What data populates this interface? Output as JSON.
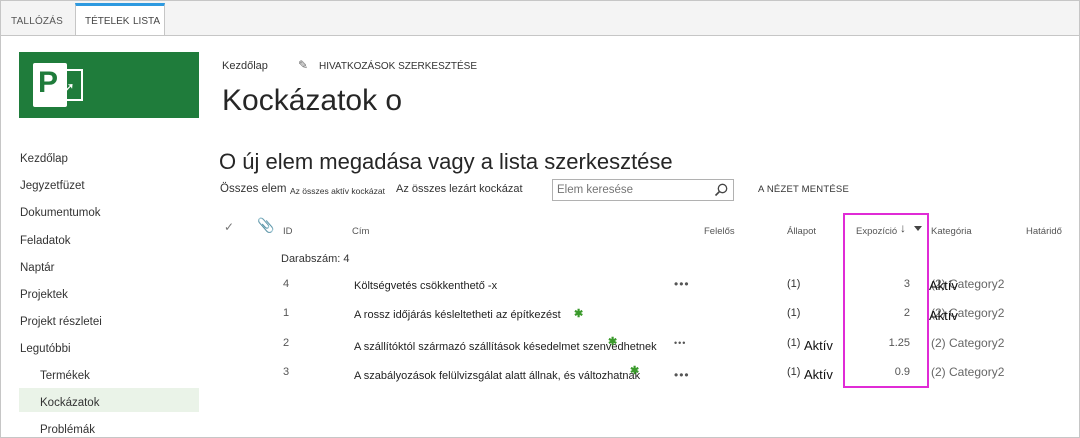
{
  "ribbon": {
    "tabs": [
      "TALLÓZÁS",
      "TÉTELEK",
      "LISTA"
    ],
    "accent": "#2e9ae0"
  },
  "brand": {
    "color": "#1f7c3b",
    "logo_letter": "P"
  },
  "breadcrumb": {
    "home": "Kezdőlap",
    "edit_links": "HIVATKOZÁSOK SZERKESZTÉSE"
  },
  "site_title": "Kockázatok o",
  "nav": {
    "items": [
      "Kezdőlap",
      "Jegyzetfüzet",
      "Dokumentumok",
      "Feladatok",
      "Naptár",
      "Projektek",
      "Projekt részletei",
      "Legutóbbi"
    ],
    "sub_items": [
      "Termékek",
      "Kockázatok",
      "Problémák"
    ],
    "selected": "Kockázatok"
  },
  "list": {
    "title": "O új elem megadása vagy a lista szerkesztése",
    "views": [
      "Összes elem",
      "Az összes aktív kockázat",
      "Az összes lezárt kockázat"
    ],
    "search_placeholder": "Elem keresése",
    "save_view": "A NÉZET MENTÉSE",
    "columns": {
      "id": "ID",
      "title": "Cím",
      "owner": "Felelős",
      "status": "Állapot",
      "exposure": "Expozíció",
      "category": "Kategória",
      "due": "Határidő"
    },
    "group": "Darabszám: 4",
    "rows": [
      {
        "id": "4",
        "title": "Költségvetés csökkenthető -x",
        "status_num": "(1)",
        "status_label": "Aktív",
        "exposure": "3",
        "category": "(2) Category2"
      },
      {
        "id": "1",
        "title": "A rossz időjárás késleltetheti az építkezést",
        "status_num": "(1)",
        "status_label": "Aktív",
        "exposure": "2",
        "category": "(2) Category2"
      },
      {
        "id": "2",
        "title": "A szállítóktól származó szállítások késedelmet szenvedhetnek",
        "status_num": "(1)",
        "status_label": "Aktív",
        "exposure": "1.25",
        "category": "(2) Category2"
      },
      {
        "id": "3",
        "title": "A szabályozások felülvizsgálat alatt állnak, és változhatnak",
        "status_num": "(1)",
        "status_label": "Aktív",
        "exposure": "0.9",
        "category": "(2) Category2"
      }
    ],
    "highlight_color": "#e02bd6"
  }
}
